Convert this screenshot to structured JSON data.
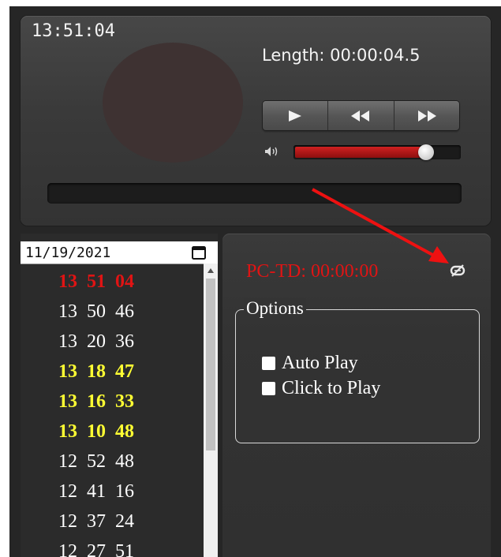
{
  "player": {
    "clock": "13:51:04",
    "length": "Length: 00:00:04.5",
    "volume_level": 0.8,
    "icons": [
      "play-icon",
      "rewind-icon",
      "fast-forward-icon",
      "volume-icon"
    ]
  },
  "date_field": {
    "value": "11/19/2021",
    "icon": "calendar-icon"
  },
  "time_list": {
    "items": [
      {
        "label": "13 51 04",
        "color": "#e01414",
        "bold": true
      },
      {
        "label": "13 50 46",
        "color": "#ffffff",
        "bold": false
      },
      {
        "label": "13 20 36",
        "color": "#ffffff",
        "bold": false
      },
      {
        "label": "13 18 47",
        "color": "#ffff33",
        "bold": true
      },
      {
        "label": "13 16 33",
        "color": "#ffff33",
        "bold": true
      },
      {
        "label": "13 10 48",
        "color": "#ffff33",
        "bold": true
      },
      {
        "label": "12 52 48",
        "color": "#ffffff",
        "bold": false
      },
      {
        "label": "12 41 16",
        "color": "#ffffff",
        "bold": false
      },
      {
        "label": "12 37 24",
        "color": "#ffffff",
        "bold": false
      },
      {
        "label": "12 27 51",
        "color": "#ffffff",
        "bold": false
      }
    ]
  },
  "right_panel": {
    "pctd": "PC-TD: 00:00:00",
    "link_icon": "broken-link-icon",
    "options": {
      "legend": "Options",
      "auto_play": "Auto Play",
      "click_to_play": "Click to Play"
    }
  },
  "colors": {
    "accent_red": "#e01414",
    "highlight_yellow": "#ffff33",
    "panel": "#2b2b2b"
  }
}
